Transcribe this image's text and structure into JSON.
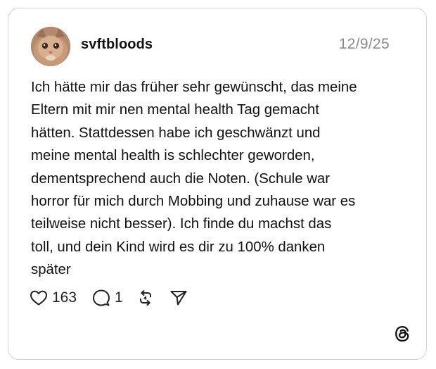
{
  "post": {
    "username": "svftbloods",
    "date": "12/9/25",
    "text": "Ich hätte mir das früher sehr gewünscht, das meine\nEltern mit mir nen mental health Tag gemacht\nhätten. Stattdessen habe ich geschwänzt und\nmeine mental health is schlechter geworden,\ndementsprechend auch die Noten. (Schule war\nhorror für mich durch Mobbing und zuhause war es\nteilweise nicht besser). Ich finde du machst das\ntoll, und dein Kind wird es dir zu 100% danken\nspäter"
  },
  "actions": {
    "likes": "163",
    "replies": "1",
    "like_icon": "heart-icon",
    "reply_icon": "comment-bubble-icon",
    "repost_icon": "repost-icon",
    "share_icon": "send-icon"
  },
  "branding": {
    "logo": "threads-logo-icon"
  }
}
